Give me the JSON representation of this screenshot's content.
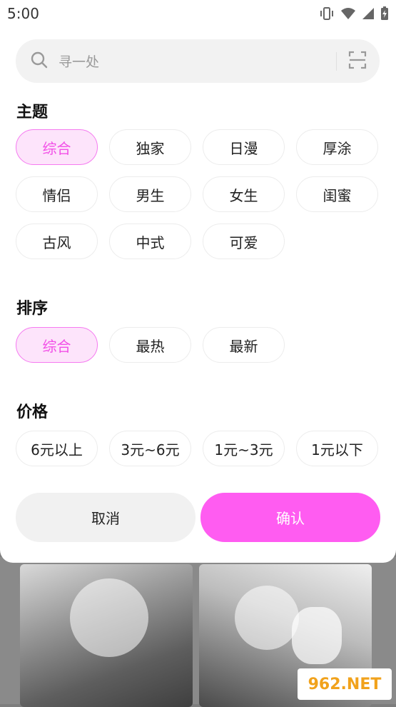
{
  "status_bar": {
    "time": "5:00",
    "icons": [
      "vibrate-icon",
      "wifi-icon",
      "signal-icon",
      "battery-charging-icon"
    ]
  },
  "search": {
    "placeholder": "寻一处",
    "icon": "search-icon",
    "scan_icon": "scan-icon"
  },
  "theme": {
    "title": "主题",
    "options": [
      "综合",
      "独家",
      "日漫",
      "厚涂",
      "情侣",
      "男生",
      "女生",
      "闺蜜",
      "古风",
      "中式",
      "可爱"
    ],
    "selected": "综合"
  },
  "sort": {
    "title": "排序",
    "options": [
      "综合",
      "最热",
      "最新"
    ],
    "selected": "综合"
  },
  "price": {
    "title": "价格",
    "options": [
      "6元以上",
      "3元~6元",
      "1元~3元",
      "1元以下"
    ]
  },
  "actions": {
    "cancel": "取消",
    "confirm": "确认"
  },
  "watermark": "962.NET",
  "colors": {
    "accent": "#ff5cf1",
    "accent_light": "#fde4fb",
    "accent_text": "#f24fe7"
  }
}
